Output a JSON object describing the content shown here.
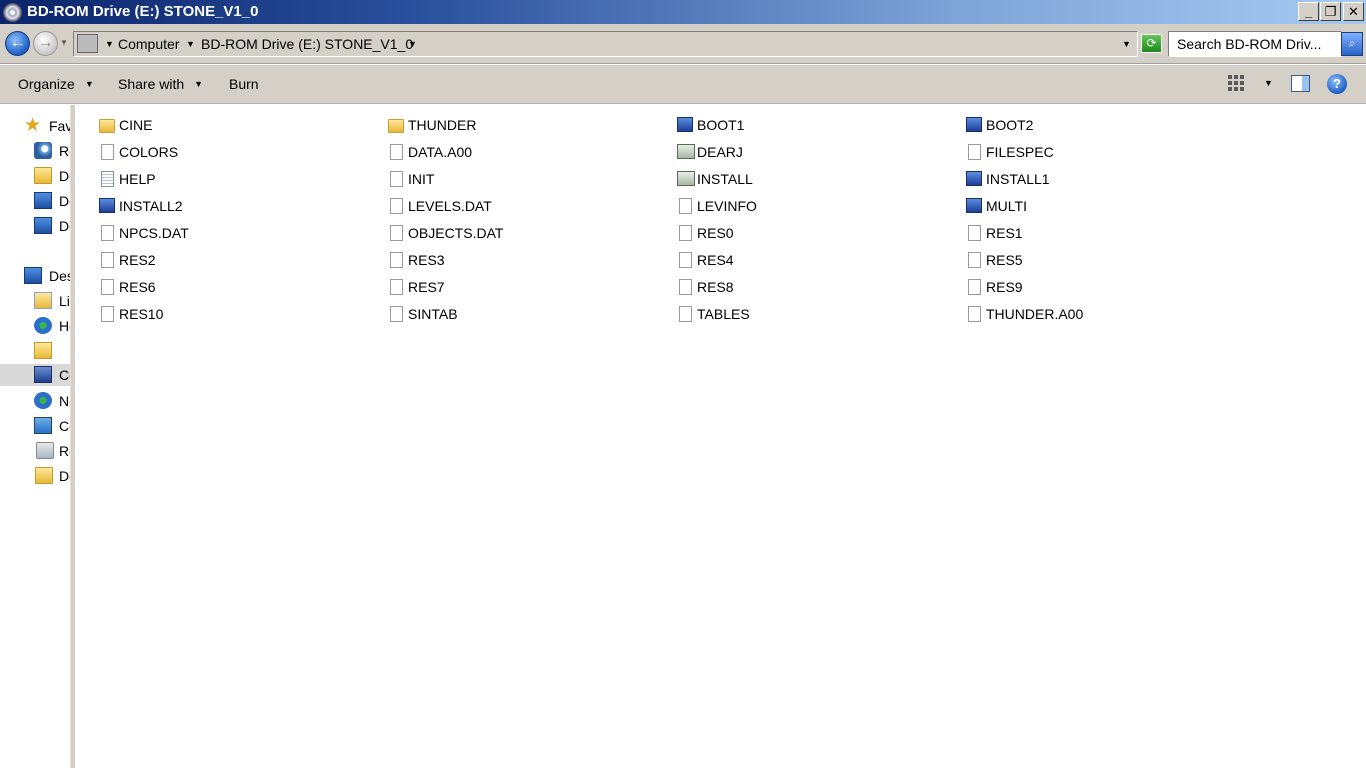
{
  "window": {
    "title": "BD-ROM Drive (E:) STONE_V1_0",
    "minimize": "_",
    "maximize": "❐",
    "close": "✕"
  },
  "address": {
    "crumbs": [
      "Computer",
      "BD-ROM Drive (E:) STONE_V1_0"
    ],
    "search_placeholder": "Search BD-ROM Driv..."
  },
  "commands": {
    "organize": "Organize",
    "share_with": "Share with",
    "burn": "Burn",
    "help": "?"
  },
  "nav": {
    "items": [
      {
        "label": "Fav",
        "icon": "star-icon"
      },
      {
        "label": "Re",
        "icon": "recent-places-icon"
      },
      {
        "label": "Do",
        "icon": "downloads-folder-icon"
      },
      {
        "label": "De",
        "icon": "desktop-icon"
      },
      {
        "label": "Do",
        "icon": "monitor-icon"
      },
      {
        "label": "Des",
        "icon": "desktop-icon"
      },
      {
        "label": "Lik",
        "icon": "libraries-icon"
      },
      {
        "label": "Ho",
        "icon": "homegroup-icon"
      },
      {
        "label": "",
        "icon": "user-folder-icon"
      },
      {
        "label": "Co",
        "icon": "computer-icon"
      },
      {
        "label": "Ne",
        "icon": "network-icon"
      },
      {
        "label": "Co",
        "icon": "control-panel-icon"
      },
      {
        "label": "Re",
        "icon": "recycle-bin-icon"
      },
      {
        "label": "Do",
        "icon": "folder-icon"
      }
    ]
  },
  "files": [
    {
      "name": "CINE",
      "type": "folder"
    },
    {
      "name": "THUNDER",
      "type": "folder"
    },
    {
      "name": "BOOT1",
      "type": "exe"
    },
    {
      "name": "BOOT2",
      "type": "exe"
    },
    {
      "name": "COLORS",
      "type": "doc"
    },
    {
      "name": "DATA.A00",
      "type": "doc"
    },
    {
      "name": "DEARJ",
      "type": "app"
    },
    {
      "name": "FILESPEC",
      "type": "doc"
    },
    {
      "name": "HELP",
      "type": "textdoc"
    },
    {
      "name": "INIT",
      "type": "doc"
    },
    {
      "name": "INSTALL",
      "type": "app"
    },
    {
      "name": "INSTALL1",
      "type": "exe"
    },
    {
      "name": "INSTALL2",
      "type": "exe"
    },
    {
      "name": "LEVELS.DAT",
      "type": "doc"
    },
    {
      "name": "LEVINFO",
      "type": "doc"
    },
    {
      "name": "MULTI",
      "type": "exe"
    },
    {
      "name": "NPCS.DAT",
      "type": "doc"
    },
    {
      "name": "OBJECTS.DAT",
      "type": "doc"
    },
    {
      "name": "RES0",
      "type": "doc"
    },
    {
      "name": "RES1",
      "type": "doc"
    },
    {
      "name": "RES2",
      "type": "doc"
    },
    {
      "name": "RES3",
      "type": "doc"
    },
    {
      "name": "RES4",
      "type": "doc"
    },
    {
      "name": "RES5",
      "type": "doc"
    },
    {
      "name": "RES6",
      "type": "doc"
    },
    {
      "name": "RES7",
      "type": "doc"
    },
    {
      "name": "RES8",
      "type": "doc"
    },
    {
      "name": "RES9",
      "type": "doc"
    },
    {
      "name": "RES10",
      "type": "doc"
    },
    {
      "name": "SINTAB",
      "type": "doc"
    },
    {
      "name": "TABLES",
      "type": "doc"
    },
    {
      "name": "THUNDER.A00",
      "type": "doc"
    }
  ]
}
